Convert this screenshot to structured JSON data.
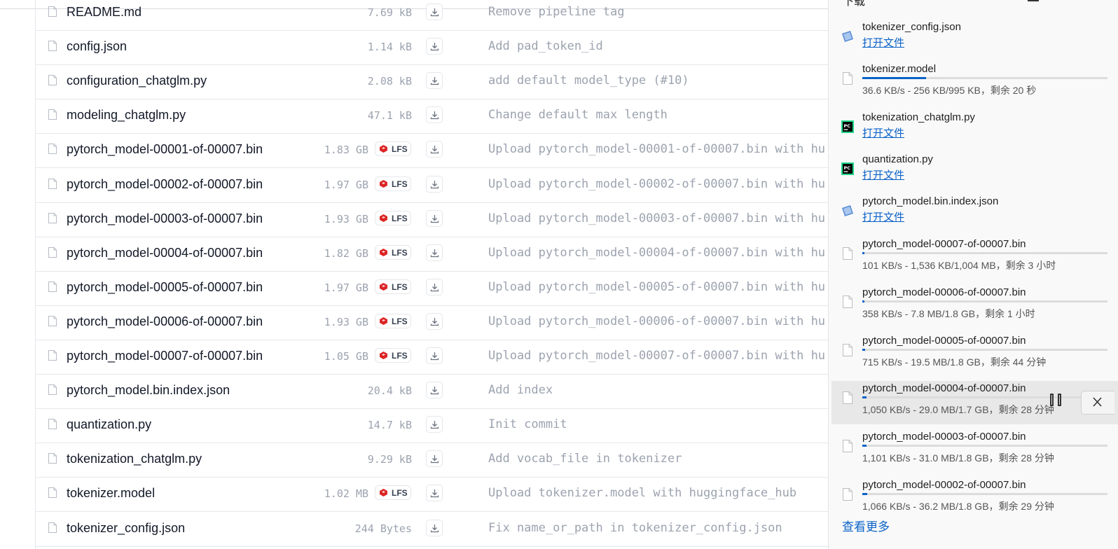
{
  "files": [
    {
      "name": "README.md",
      "size": "7.69 kB",
      "lfs": false,
      "commit": "Remove pipeline tag"
    },
    {
      "name": "config.json",
      "size": "1.14 kB",
      "lfs": false,
      "commit": "Add pad_token_id"
    },
    {
      "name": "configuration_chatglm.py",
      "size": "2.08 kB",
      "lfs": false,
      "commit": "add default model_type (#10)"
    },
    {
      "name": "modeling_chatglm.py",
      "size": "47.1 kB",
      "lfs": false,
      "commit": "Change default max length"
    },
    {
      "name": "pytorch_model-00001-of-00007.bin",
      "size": "1.83 GB",
      "lfs": true,
      "commit": "Upload pytorch_model-00001-of-00007.bin with hu"
    },
    {
      "name": "pytorch_model-00002-of-00007.bin",
      "size": "1.97 GB",
      "lfs": true,
      "commit": "Upload pytorch_model-00002-of-00007.bin with hu"
    },
    {
      "name": "pytorch_model-00003-of-00007.bin",
      "size": "1.93 GB",
      "lfs": true,
      "commit": "Upload pytorch_model-00003-of-00007.bin with hu"
    },
    {
      "name": "pytorch_model-00004-of-00007.bin",
      "size": "1.82 GB",
      "lfs": true,
      "commit": "Upload pytorch_model-00004-of-00007.bin with hu"
    },
    {
      "name": "pytorch_model-00005-of-00007.bin",
      "size": "1.97 GB",
      "lfs": true,
      "commit": "Upload pytorch_model-00005-of-00007.bin with hu"
    },
    {
      "name": "pytorch_model-00006-of-00007.bin",
      "size": "1.93 GB",
      "lfs": true,
      "commit": "Upload pytorch_model-00006-of-00007.bin with hu"
    },
    {
      "name": "pytorch_model-00007-of-00007.bin",
      "size": "1.05 GB",
      "lfs": true,
      "commit": "Upload pytorch_model-00007-of-00007.bin with hu"
    },
    {
      "name": "pytorch_model.bin.index.json",
      "size": "20.4 kB",
      "lfs": false,
      "commit": "Add index"
    },
    {
      "name": "quantization.py",
      "size": "14.7 kB",
      "lfs": false,
      "commit": "Init commit"
    },
    {
      "name": "tokenization_chatglm.py",
      "size": "9.29 kB",
      "lfs": false,
      "commit": "Add vocab_file in tokenizer"
    },
    {
      "name": "tokenizer.model",
      "size": "1.02 MB",
      "lfs": true,
      "commit": "Upload tokenizer.model with huggingface_hub"
    },
    {
      "name": "tokenizer_config.json",
      "size": "244 Bytes",
      "lfs": false,
      "commit": "Fix name_or_path in tokenizer_config.json"
    }
  ],
  "lfs_label": "LFS",
  "downloads": {
    "header_title": "下载",
    "see_more": "查看更多",
    "open_label": "打开文件",
    "items": [
      {
        "name": "tokenizer_config.json",
        "icon": "json-file-icon",
        "done": true
      },
      {
        "name": "tokenizer.model",
        "icon": "blank-file-icon",
        "done": false,
        "status": "36.6 KB/s - 256 KB/995 KB，剩余 20 秒",
        "progress": 0.26
      },
      {
        "name": "tokenization_chatglm.py",
        "icon": "pycharm-file-icon",
        "done": true
      },
      {
        "name": "quantization.py",
        "icon": "pycharm-file-icon",
        "done": true
      },
      {
        "name": "pytorch_model.bin.index.json",
        "icon": "json-file-icon",
        "done": true
      },
      {
        "name": "pytorch_model-00007-of-00007.bin",
        "icon": "blank-file-icon",
        "done": false,
        "status": "101 KB/s - 1,536 KB/1,004 MB，剩余 3 小时",
        "progress": 0.002
      },
      {
        "name": "pytorch_model-00006-of-00007.bin",
        "icon": "blank-file-icon",
        "done": false,
        "status": "358 KB/s - 7.8 MB/1.8 GB，剩余 1 小时",
        "progress": 0.004
      },
      {
        "name": "pytorch_model-00005-of-00007.bin",
        "icon": "blank-file-icon",
        "done": false,
        "status": "715 KB/s - 19.5 MB/1.8 GB，剩余 44 分钟",
        "progress": 0.011
      },
      {
        "name": "pytorch_model-00004-of-00007.bin",
        "icon": "blank-file-icon",
        "done": false,
        "status": "1,050 KB/s - 29.0 MB/1.7 GB，剩余 28 分钟",
        "progress": 0.017,
        "hover": true
      },
      {
        "name": "pytorch_model-00003-of-00007.bin",
        "icon": "blank-file-icon",
        "done": false,
        "status": "1,101 KB/s - 31.0 MB/1.8 GB，剩余 28 分钟",
        "progress": 0.017
      },
      {
        "name": "pytorch_model-00002-of-00007.bin",
        "icon": "blank-file-icon",
        "done": false,
        "status": "1,066 KB/s - 36.2 MB/1.8 GB，剩余 29 分钟",
        "progress": 0.02
      }
    ]
  },
  "colors": {
    "link": "#0a62c9",
    "lfs_red": "#dc2626",
    "muted": "#9ca3af"
  }
}
